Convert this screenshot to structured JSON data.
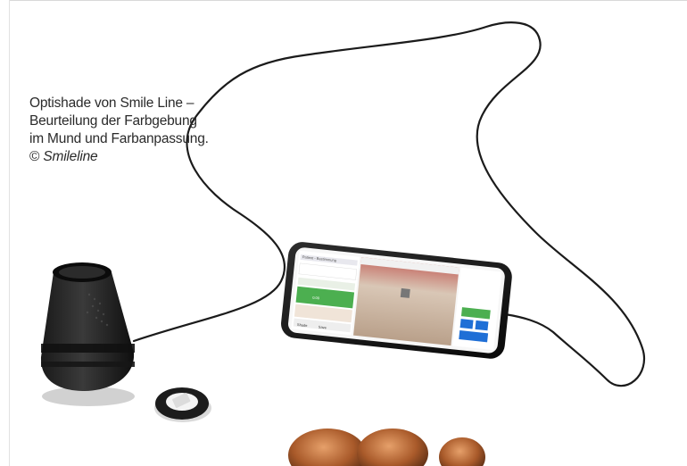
{
  "caption": {
    "line1": "Optishade von Smile Line –",
    "line2": "Beurteilung der Farbgebung",
    "line3": "im Mund und Farbanpassung.",
    "copyright_symbol": "©",
    "credit": "Smileline"
  },
  "photo_subject": {
    "icons": [
      "optishade-device",
      "smartphone",
      "usb-cable",
      "eyepiece-ring",
      "dental-crowns"
    ]
  },
  "phone_screen": {
    "app_title": "Patient - Bestimmung",
    "shade_button": "Shade",
    "status_green": "0.00",
    "save_button": "Save"
  }
}
